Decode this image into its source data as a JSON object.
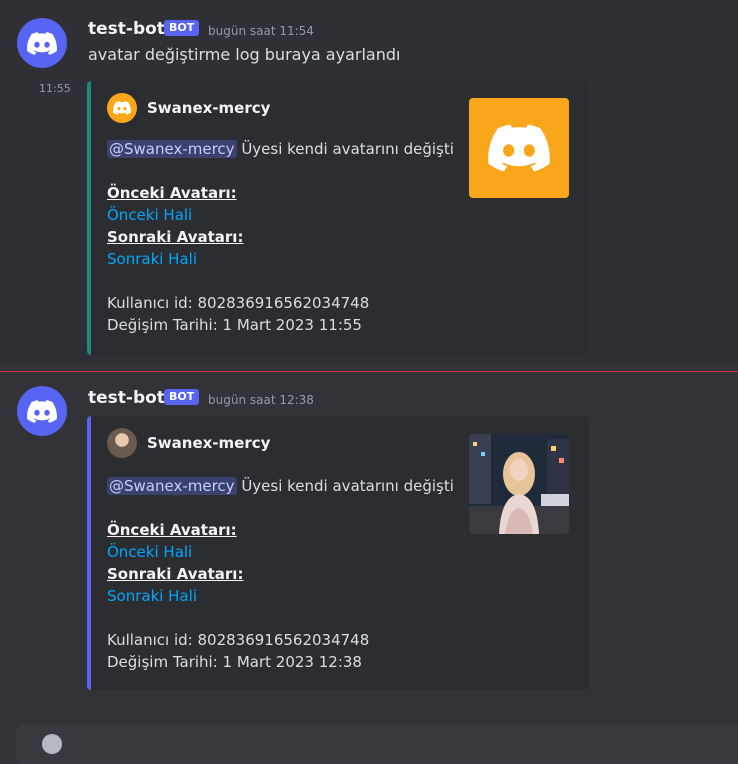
{
  "messages": [
    {
      "author": "test-bot",
      "tag": "BOT",
      "timestamp": "bugün saat 11:54",
      "content": "avatar değiştirme log buraya ayarlandı"
    },
    {
      "side_time": "11:55",
      "embed": {
        "accent_color": "#1f8b74",
        "author_name": "Swanex-mercy",
        "mention": "@Swanex-mercy",
        "description_text": " Üyesi kendi avatarını değişti",
        "old_avatar_title": "Önceki Avatarı:",
        "old_avatar_link": "Önceki Hali",
        "new_avatar_title": "Sonraki Avatarı:",
        "new_avatar_link": "Sonraki Hali",
        "user_id_line": "Kullanıcı id: 802836916562034748",
        "date_line": "Değişim Tarihi: 1 Mart 2023 11:55",
        "thumbnail": "default-discord-avatar-orange",
        "author_icon": "default-discord-avatar-orange"
      }
    },
    {
      "author": "test-bot",
      "tag": "BOT",
      "timestamp": "bugün saat 12:38",
      "embed": {
        "accent_color": "#5865f2",
        "author_name": "Swanex-mercy",
        "mention": "@Swanex-mercy",
        "description_text": " Üyesi kendi avatarını değişti",
        "old_avatar_title": "Önceki Avatarı:",
        "old_avatar_link": "Önceki Hali",
        "new_avatar_title": "Sonraki Avatarı:",
        "new_avatar_link": "Sonraki Hali",
        "user_id_line": "Kullanıcı id: 802836916562034748",
        "date_line": "Değişim Tarihi: 1 Mart 2023 12:38",
        "thumbnail": "user-photo-avatar",
        "author_icon": "user-photo-avatar"
      }
    }
  ],
  "colors": {
    "background": "#313338",
    "embed_bg": "#2b2d31",
    "blurple": "#5865f2",
    "link": "#00a8fc",
    "new_messages_divider": "#f23f43"
  }
}
